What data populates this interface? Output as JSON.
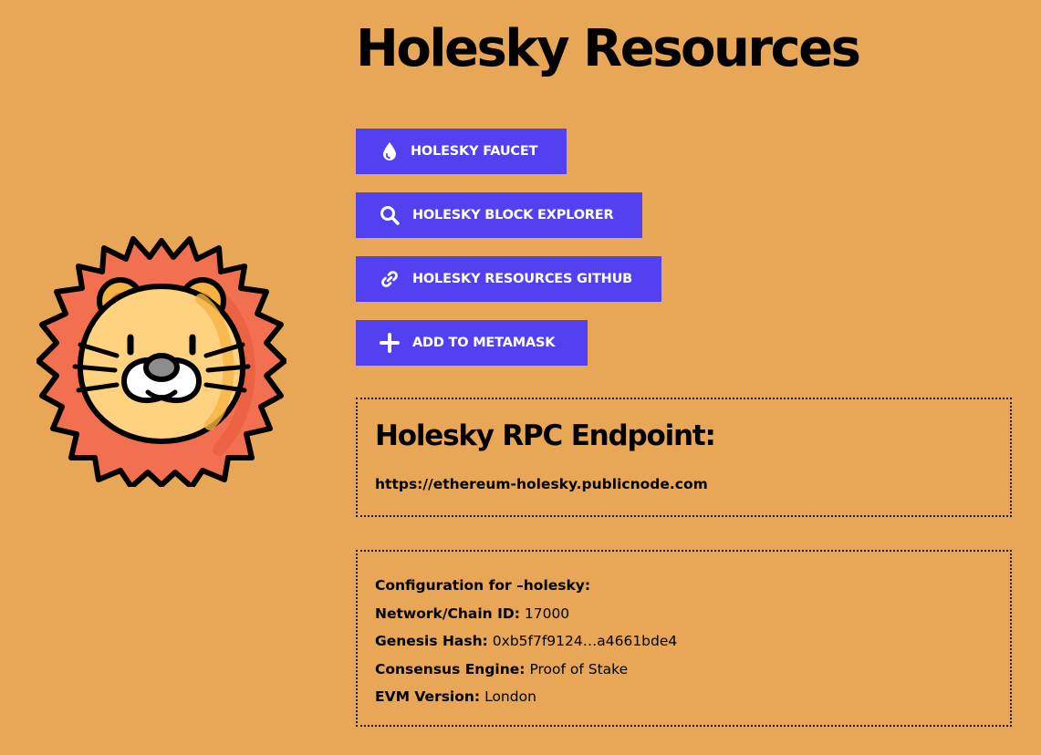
{
  "page": {
    "title": "Holesky Resources"
  },
  "buttons": {
    "faucet": {
      "label": "HOLESKY FAUCET",
      "icon": "water-drop-icon"
    },
    "explorer": {
      "label": "HOLESKY BLOCK EXPLORER",
      "icon": "search-icon"
    },
    "github": {
      "label": "HOLESKY RESOURCES GITHUB",
      "icon": "link-icon"
    },
    "metamask": {
      "label": "ADD TO METAMASK",
      "icon": "plus-icon"
    }
  },
  "rpc": {
    "title": "Holesky RPC Endpoint:",
    "url": "https://ethereum-holesky.publicnode.com"
  },
  "config": {
    "heading": "Configuration for –holesky:",
    "chain_id_label": "Network/Chain ID:",
    "chain_id_value": "17000",
    "genesis_label": "Genesis Hash:",
    "genesis_value": "0xb5f7f9124…a4661bde4",
    "consensus_label": "Consensus Engine:",
    "consensus_value": "Proof of Stake",
    "evm_label": "EVM Version:",
    "evm_value": "London"
  },
  "colors": {
    "background": "#E8A657",
    "button": "#5241F0",
    "button_text": "#FFFFFF",
    "mane": "#F2704F",
    "face": "#FFD27F",
    "ear_inner": "#F6B343",
    "outline": "#000000"
  },
  "logo": {
    "icon": "lion-logo"
  }
}
